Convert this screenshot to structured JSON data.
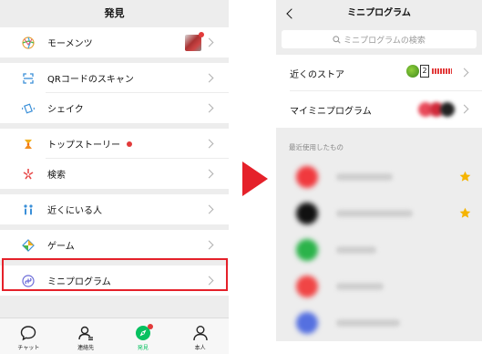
{
  "left": {
    "title": "発見",
    "rows": [
      {
        "label": "モーメンツ",
        "icon": "moments-icon"
      },
      {
        "label": "QRコードのスキャン",
        "icon": "scan-icon"
      },
      {
        "label": "シェイク",
        "icon": "shake-icon"
      },
      {
        "label": "トップストーリー",
        "icon": "top-stories-icon"
      },
      {
        "label": "検索",
        "icon": "search-icon"
      },
      {
        "label": "近くにいる人",
        "icon": "people-nearby-icon"
      },
      {
        "label": "ゲーム",
        "icon": "games-icon"
      },
      {
        "label": "ミニプログラム",
        "icon": "mini-program-icon"
      }
    ],
    "tabs": [
      {
        "label": "チャット",
        "icon": "chat-icon"
      },
      {
        "label": "連絡先",
        "icon": "contacts-icon"
      },
      {
        "label": "発見",
        "icon": "discover-icon"
      },
      {
        "label": "本人",
        "icon": "me-icon"
      }
    ]
  },
  "right": {
    "title": "ミニプログラム",
    "search_placeholder": "ミニプログラムの検索",
    "nearby_store": "近くのストア",
    "store_tag": "2",
    "my_mini_programs": "マイミニプログラム",
    "recent_title": "最近使用したもの",
    "recent_apps": [
      {
        "color": "#f0393e",
        "starred": true
      },
      {
        "color": "#111111",
        "starred": true
      },
      {
        "color": "#2bb34a",
        "starred": false
      },
      {
        "color": "#f04545",
        "starred": false
      },
      {
        "color": "#5570e0",
        "starred": false
      }
    ]
  },
  "colors": {
    "accent_green": "#07c160",
    "highlight_red": "#e5212a",
    "star_yellow": "#f5b400",
    "badge_red": "#e23a3a"
  }
}
